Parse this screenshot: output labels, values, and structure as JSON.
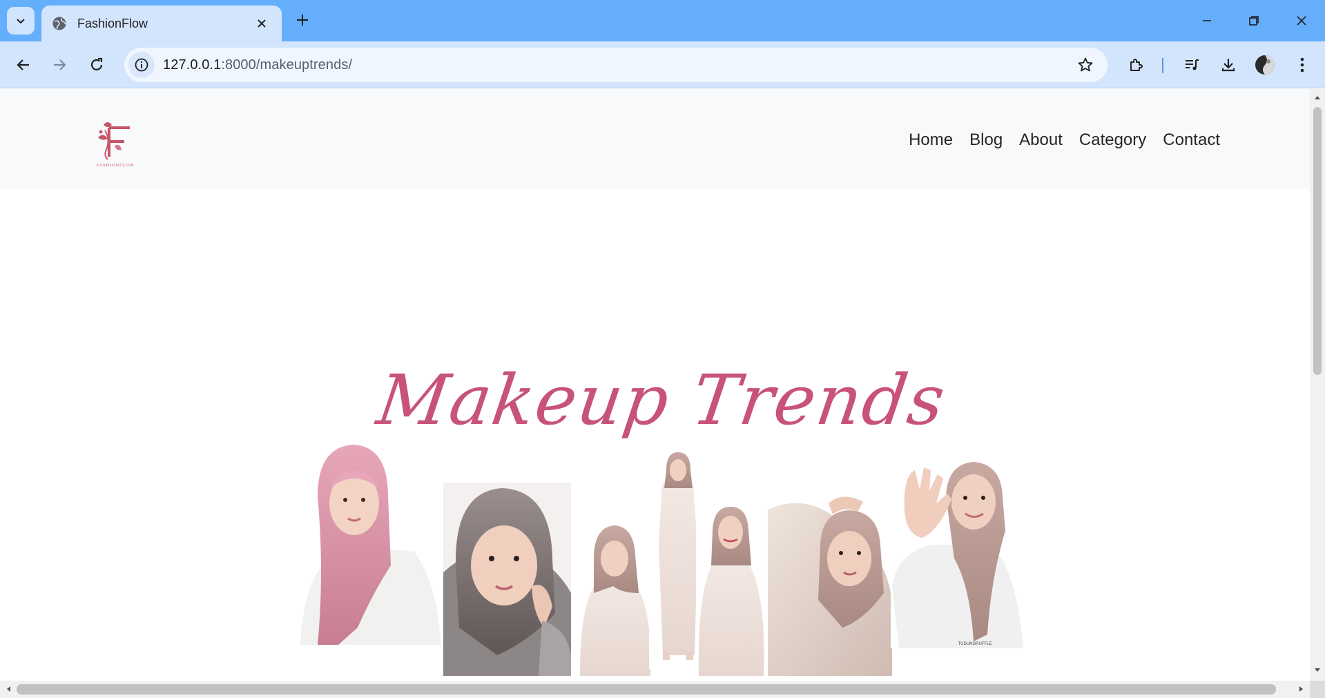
{
  "browser": {
    "tab_title": "FashionFlow",
    "url_host": "127.0.0.1",
    "url_path": ":8000/makeuptrends/",
    "icons": [
      "tab-search-icon",
      "globe-icon",
      "close-icon",
      "plus-icon",
      "minimize-icon",
      "restore-icon",
      "window-close-icon",
      "back-arrow-icon",
      "forward-arrow-icon",
      "reload-icon",
      "site-info-icon",
      "bookmark-star-icon",
      "extensions-icon",
      "media-controls-icon",
      "download-icon",
      "profile-avatar-icon",
      "kebab-menu-icon"
    ],
    "accent": "#65aefc"
  },
  "site": {
    "logo_text": "FASHIONFLOW",
    "nav": [
      {
        "label": "Home"
      },
      {
        "label": "Blog"
      },
      {
        "label": "About"
      },
      {
        "label": "Category"
      },
      {
        "label": "Contact"
      }
    ],
    "hero_title": "Makeup Trends",
    "hero_image_watermark": "TUDUNGRUFFLE",
    "brand_color": "#c8537a"
  }
}
